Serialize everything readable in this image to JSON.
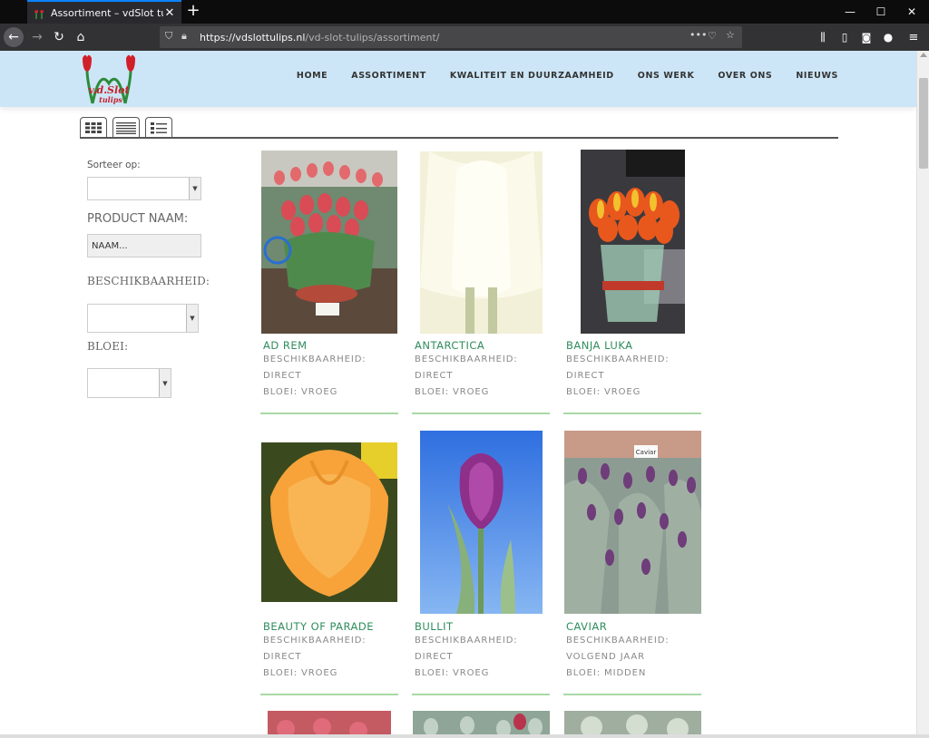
{
  "browser": {
    "tab_title": "Assortiment – vdSlot tulips",
    "url_host": "https://vdslottulips.nl",
    "url_path": "/vd-slot-tulips/assortiment/",
    "url_menu": "•••"
  },
  "site": {
    "logo_text_top": "v.d.Slot",
    "logo_text_bottom": "tulips",
    "nav": [
      "HOME",
      "ASSORTIMENT",
      "KWALITEIT EN DUURZAAMHEID",
      "ONS WERK",
      "OVER ONS",
      "NIEUWS"
    ]
  },
  "filters": {
    "sort_label": "Sorteer op:",
    "product_name_label": "PRODUCT NAAM:",
    "name_placeholder": "NAAM...",
    "availability_label": "BESCHIKBAARHEID:",
    "bloom_label": "BLOEI:"
  },
  "products": [
    {
      "name": "AD REM",
      "avail_label": "BESCHIKBAARHEID:",
      "avail": "DIRECT",
      "bloom": "BLOEI: VROEG"
    },
    {
      "name": "ANTARCTICA",
      "avail_label": "BESCHIKBAARHEID:",
      "avail": "DIRECT",
      "bloom": "BLOEI: VROEG"
    },
    {
      "name": "BANJA LUKA",
      "avail_label": "BESCHIKBAARHEID:",
      "avail": "DIRECT",
      "bloom": "BLOEI: VROEG"
    },
    {
      "name": "BEAUTY OF PARADE",
      "avail_label": "BESCHIKBAARHEID:",
      "avail": "DIRECT",
      "bloom": "BLOEI: VROEG"
    },
    {
      "name": "BULLIT",
      "avail_label": "BESCHIKBAARHEID:",
      "avail": "DIRECT",
      "bloom": "BLOEI: VROEG"
    },
    {
      "name": "CAVIAR",
      "avail_label": "BESCHIKBAARHEID:",
      "avail": "VOLGEND JAAR",
      "bloom": "BLOEI: MIDDEN",
      "photo_tag": "Caviar"
    }
  ],
  "colors": {
    "accent_green": "#2f8d5c",
    "header_blue": "#cce6f7",
    "divider_green": "#a9d9a6"
  }
}
